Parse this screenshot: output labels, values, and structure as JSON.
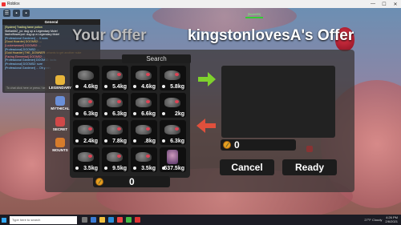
{
  "window": {
    "title": "Roblox",
    "controls": [
      "—",
      "☐",
      "✕"
    ]
  },
  "chat": {
    "tab": "General",
    "lines": [
      "[System] Trading fame potion",
      "Stellar##2_yo: dug up a Legendary Mole!",
      "liachxiflowerpot: dug up a Legendary Mole!",
      "[Professional Gardener] ... 9 rows",
      "[Good Hoarder] DOOM52: ...",
      "[Lockerweasel] DOOM52: ...",
      "[Professional] DOOM52: ...",
      "[Gold Hoarder] THE_DOWNER: whants to get another nuke",
      "[Facing Elemental] DOOM52: ...",
      "[Professional Gardener] DOOM52: lacks",
      "[Professional] DOOM52: sure",
      "[Professional Gardener] ... Oh yeah"
    ],
    "input_placeholder": "To chat click here or press / key"
  },
  "player_tag": "[Noob#55]",
  "offers": {
    "your_offer_title": "Your Offer",
    "their_offer_title": "kingstonlovesA's Offer"
  },
  "search": {
    "label": "Search"
  },
  "categories": [
    {
      "label": "LEGENDARY",
      "color": "#e8b53a"
    },
    {
      "label": "MYTHICAL",
      "color": "#6a8fd8"
    },
    {
      "label": "SECRET",
      "color": "#d04848"
    },
    {
      "label": "MOUNTS",
      "color": "#d77c2c"
    }
  ],
  "inventory": [
    {
      "weight": "4.6kg",
      "type": "mole",
      "spot": false
    },
    {
      "weight": "5.4kg",
      "type": "mole",
      "spot": true
    },
    {
      "weight": "4.6kg",
      "type": "mole",
      "spot": true
    },
    {
      "weight": "5.8kg",
      "type": "mole",
      "spot": true
    },
    {
      "weight": "6.3kg",
      "type": "mole",
      "spot": true
    },
    {
      "weight": "6.3kg",
      "type": "mole",
      "spot": true
    },
    {
      "weight": "6.6kg",
      "type": "mole",
      "spot": true
    },
    {
      "weight": "2kg",
      "type": "mole",
      "spot": true
    },
    {
      "weight": "2.4kg",
      "type": "mole",
      "spot": true
    },
    {
      "weight": "7.8kg",
      "type": "mole",
      "spot": true
    },
    {
      "weight": ".8kg",
      "type": "mole",
      "spot": true
    },
    {
      "weight": "6.3kg",
      "type": "mole",
      "spot": true
    },
    {
      "weight": "3.5kg",
      "type": "mole",
      "spot": true
    },
    {
      "weight": "9.5kg",
      "type": "mole",
      "spot": true
    },
    {
      "weight": "3.5kg",
      "type": "mole",
      "spot": true
    },
    {
      "weight": "537.5kg",
      "type": "special",
      "spot": false
    }
  ],
  "your_coins": "0",
  "their_coins": "0",
  "buttons": {
    "cancel": "Cancel",
    "ready": "Ready"
  },
  "taskbar": {
    "search_placeholder": "Type here to search",
    "weather": "27°F Cloudy",
    "time": "4:26 PM",
    "date": "2/6/2021"
  },
  "colors": {
    "green_arrow": "#7fd12d",
    "red_arrow": "#e0503c",
    "coin": "#e8a020"
  }
}
